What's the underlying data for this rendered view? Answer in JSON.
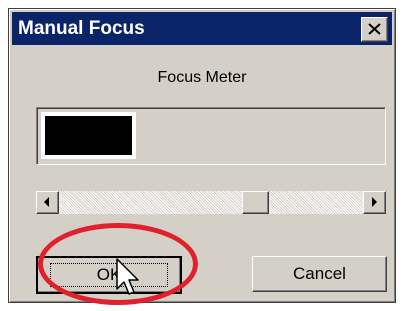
{
  "dialog": {
    "title": "Manual Focus",
    "close_icon": "close-icon",
    "meter_label": "Focus Meter",
    "meter_level": 0.28,
    "slider": {
      "value": 0.66
    },
    "buttons": {
      "ok": "OK",
      "cancel": "Cancel"
    }
  },
  "colors": {
    "titlebar": "#0a246a",
    "face": "#d4d0c8",
    "meter_fill": "#000000",
    "highlight": "#e0202a"
  }
}
